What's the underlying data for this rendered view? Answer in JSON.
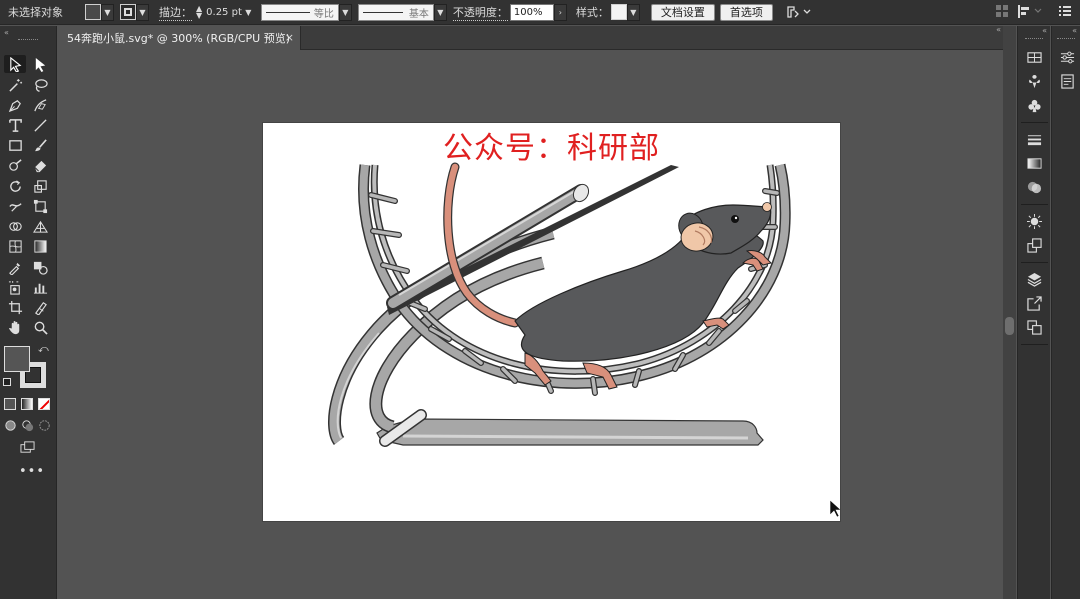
{
  "control_bar": {
    "selection_status": "未选择对象",
    "stroke_label": "描边：",
    "stroke_value": "0.25 pt",
    "profile_label": "等比",
    "brush_label": "基本",
    "opacity_label": "不透明度：",
    "opacity_value": "100%",
    "style_label": "样式：",
    "doc_setup_button": "文档设置",
    "preferences_button": "首选项"
  },
  "document_tab": {
    "title": "54奔跑小鼠.svg* @ 300% (RGB/CPU 预览)",
    "close_glyph": "×"
  },
  "artboard": {
    "title": "公众号：科研部",
    "title_color": "#e02020"
  },
  "colors": {
    "app_bg": "#535353",
    "panel_bg": "#323232",
    "rat_body": "#58595b",
    "rat_skin": "#d9907c",
    "wheel": "#a7a7a7",
    "cursor": "#111111"
  },
  "tools": [
    "selection-tool",
    "direct-selection-tool",
    "magic-wand-tool",
    "lasso-tool",
    "pen-tool",
    "curvature-tool",
    "type-tool",
    "line-tool",
    "rectangle-tool",
    "paintbrush-tool",
    "shaper-tool",
    "eraser-tool",
    "rotate-tool",
    "scale-tool",
    "warp-tool",
    "free-transform-tool",
    "shape-builder-tool",
    "perspective-grid-tool",
    "mesh-tool",
    "gradient-tool",
    "eyedropper-tool",
    "blend-tool",
    "symbol-sprayer-tool",
    "column-graph-tool",
    "artboard-tool",
    "slice-tool",
    "hand-tool",
    "zoom-tool"
  ],
  "right_panel_icons": [
    "libraries-icon",
    "symbols-icon",
    "club-icon",
    "stroke-icon",
    "gradient-icon",
    "transparency-icon",
    "appearance-icon",
    "graphic-styles-icon",
    "layers-icon",
    "export-icon",
    "artboards-icon"
  ]
}
